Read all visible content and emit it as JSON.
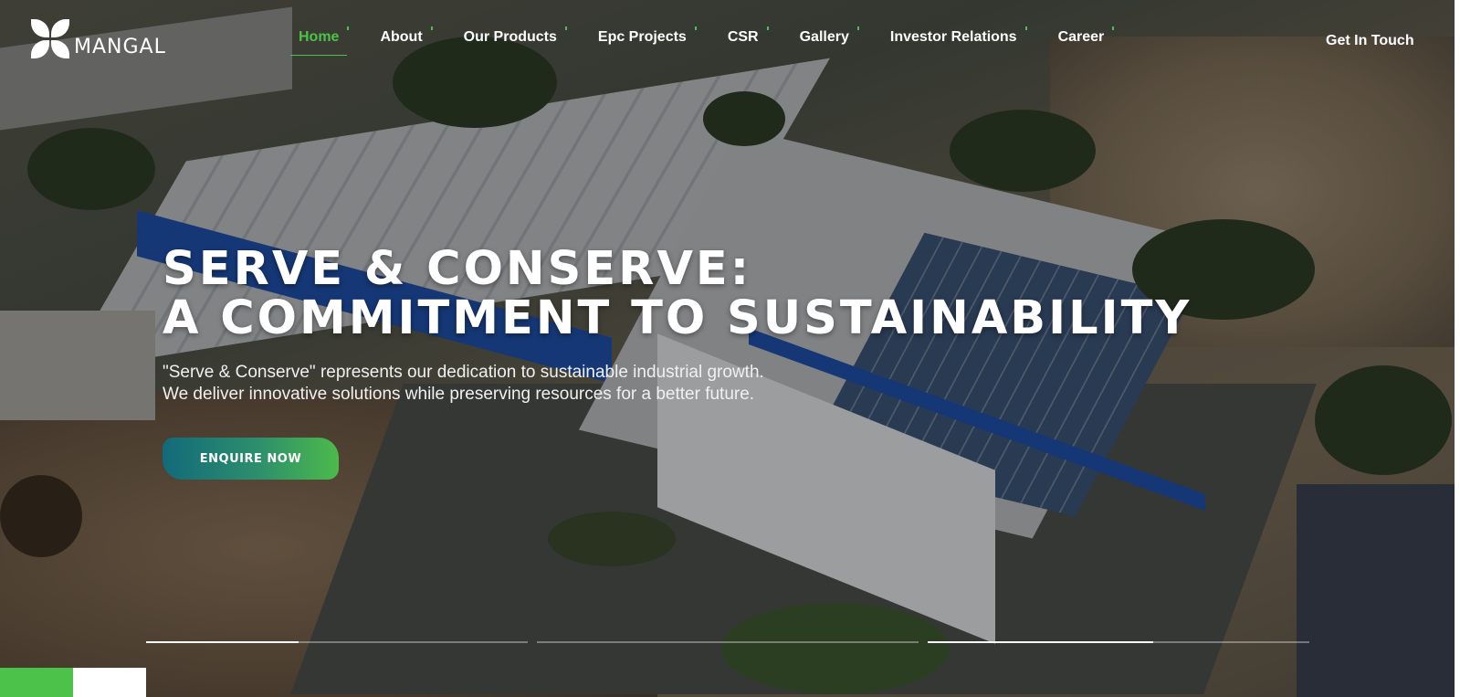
{
  "brand": {
    "name": "MANGAL"
  },
  "nav": {
    "items": [
      {
        "label": "Home",
        "active": true
      },
      {
        "label": "About"
      },
      {
        "label": "Our Products"
      },
      {
        "label": "Epc Projects"
      },
      {
        "label": "CSR"
      },
      {
        "label": "Gallery"
      },
      {
        "label": "Investor Relations"
      },
      {
        "label": "Career"
      }
    ],
    "cta": "Get In Touch"
  },
  "hero": {
    "headline_line1": "Serve & Conserve:",
    "headline_line2": "A Commitment to Sustainability",
    "description_line1": "\"Serve & Conserve\" represents our dedication to sustainable industrial growth.",
    "description_line2": "We deliver innovative solutions while preserving resources for a better future.",
    "button": "ENQUIRE NOW"
  },
  "slider": {
    "slides": [
      {
        "progress": 0.4
      },
      {
        "progress": 0.0
      },
      {
        "progress": 0.59
      }
    ]
  },
  "colors": {
    "accent_green": "#4cc24a",
    "button_gradient_start": "#126a7a",
    "button_gradient_end": "#4cba4b"
  }
}
